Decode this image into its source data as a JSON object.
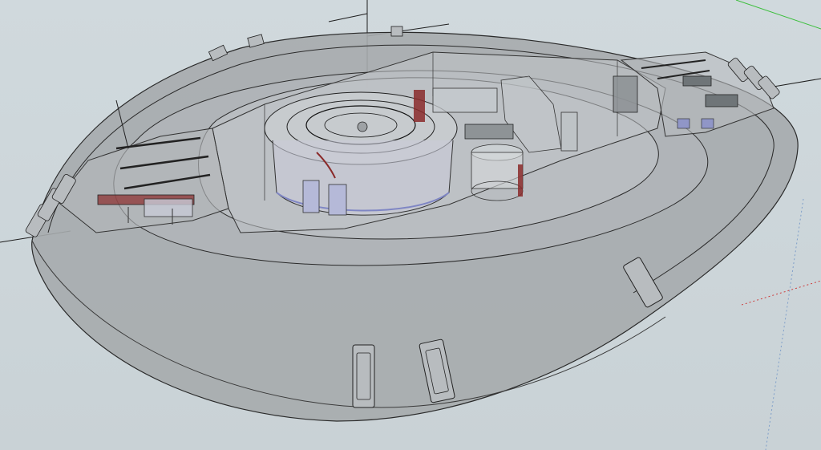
{
  "app": {
    "type": "3d-modeling-viewport"
  },
  "scene": {
    "object": "bridge-module-saucer",
    "style": "x-ray-transparent"
  },
  "colors": {
    "background": "#cfd8dc",
    "hull_fill": "#a9aeb0",
    "hull_stroke": "#2a2a2a",
    "interior_fill": "#b9bdc0",
    "accent_red": "#8a2a2a",
    "accent_blue": "#7f86c4",
    "axis_green": "#3cbf3c",
    "axis_red": "#cc3b3b",
    "axis_black": "#1e1e1e"
  },
  "axes": [
    "x-axis-red",
    "y-axis-green",
    "z-axis-blue"
  ]
}
